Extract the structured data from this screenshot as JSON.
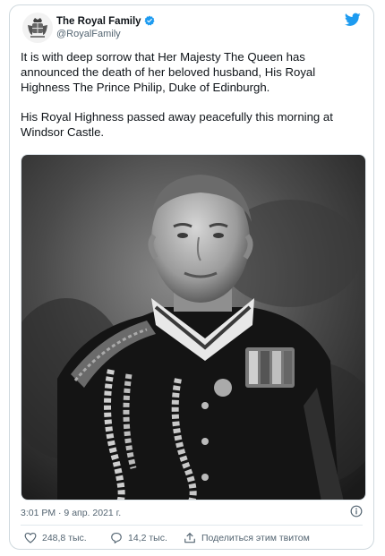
{
  "tweet": {
    "author_name": "The Royal Family",
    "author_handle": "@RoyalFamily",
    "paragraphs": [
      "It is with deep sorrow that Her Majesty The Queen has announced the death of her beloved husband, His Royal Highness The Prince Philip, Duke of Edinburgh.",
      "His Royal Highness passed away peacefully this morning at Windsor Castle."
    ],
    "timestamp": "3:01 PM · 9 апр. 2021 г.",
    "likes_count": "248,8 тыс.",
    "replies_count": "14,2 тыс.",
    "share_label": "Поделиться этим твитом"
  },
  "colors": {
    "verified": "#1d9bf0",
    "twitter_brand": "#1d9bf0",
    "text_primary": "#0f1419",
    "text_secondary": "#536471"
  },
  "icons": [
    "royal-crest-icon",
    "verified-badge-icon",
    "twitter-bird-icon",
    "info-icon",
    "heart-icon",
    "reply-icon",
    "share-icon"
  ]
}
